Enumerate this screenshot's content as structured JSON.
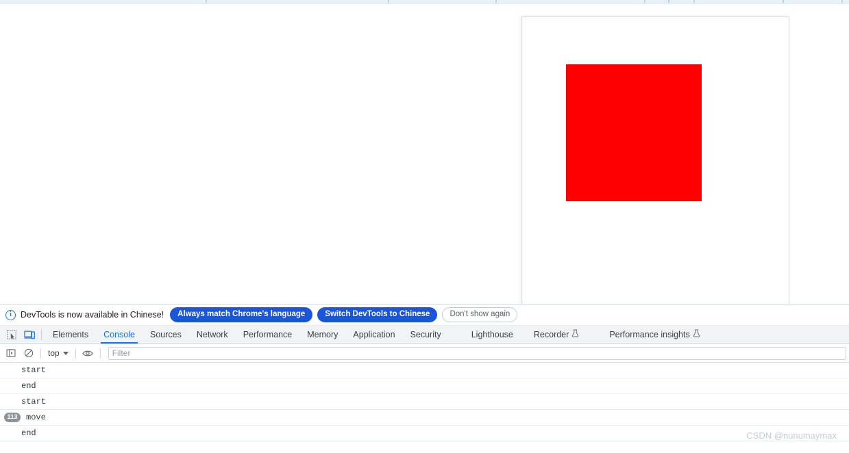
{
  "viewport": {
    "device_frame_name": "device-emulation-frame",
    "content": {
      "red_box_color": "#fe0000",
      "red_box_name": "red-draggable-box"
    }
  },
  "devtools": {
    "banner": {
      "icon": "info-icon",
      "message": "DevTools is now available in Chinese!",
      "buttons": [
        {
          "label": "Always match Chrome's language",
          "style": "primary"
        },
        {
          "label": "Switch DevTools to Chinese",
          "style": "primary"
        },
        {
          "label": "Don't show again",
          "style": "ghost"
        }
      ]
    },
    "toolbar_icons": [
      {
        "name": "inspect-element-icon",
        "state": "inactive"
      },
      {
        "name": "device-toolbar-icon",
        "state": "active"
      }
    ],
    "tabs": [
      {
        "label": "Elements",
        "active": false,
        "experimental": false
      },
      {
        "label": "Console",
        "active": true,
        "experimental": false
      },
      {
        "label": "Sources",
        "active": false,
        "experimental": false
      },
      {
        "label": "Network",
        "active": false,
        "experimental": false
      },
      {
        "label": "Performance",
        "active": false,
        "experimental": false
      },
      {
        "label": "Memory",
        "active": false,
        "experimental": false
      },
      {
        "label": "Application",
        "active": false,
        "experimental": false
      },
      {
        "label": "Security",
        "active": false,
        "experimental": false
      },
      {
        "label": "Lighthouse",
        "active": false,
        "experimental": false
      },
      {
        "label": "Recorder",
        "active": false,
        "experimental": true
      },
      {
        "label": "Performance insights",
        "active": false,
        "experimental": true
      }
    ],
    "console_toolbar": {
      "sidebar_icon": "console-sidebar-icon",
      "clear_icon": "clear-console-icon",
      "context": "top",
      "context_caret": "chevron-down-icon",
      "eye_icon": "live-expression-eye-icon",
      "filter_placeholder": "Filter",
      "filter_value": ""
    },
    "console_messages": [
      {
        "count": "",
        "text": "start"
      },
      {
        "count": "",
        "text": "end"
      },
      {
        "count": "",
        "text": "start"
      },
      {
        "count": "113",
        "text": "move"
      },
      {
        "count": "",
        "text": "end"
      }
    ]
  },
  "watermark": {
    "text": "CSDN @nunumaymax"
  },
  "colors": {
    "accent": "#1a73e8",
    "button_blue": "#1a56db",
    "tab_bg": "#f1f3f4",
    "red_box": "#fe0000"
  }
}
